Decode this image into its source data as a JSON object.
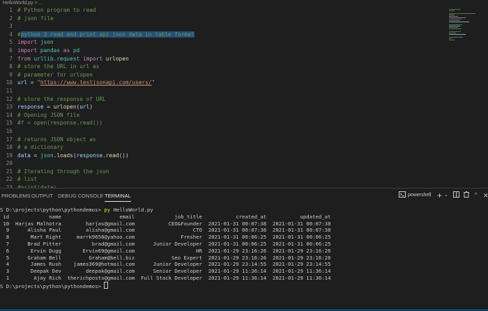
{
  "breadcrumb": "HelloWorld.py > ...",
  "editor": {
    "lines": [
      [
        [
          "# Python program to read",
          "comment"
        ]
      ],
      [
        [
          "# json file",
          "comment"
        ]
      ],
      [],
      [
        [
          "#",
          "comment"
        ],
        [
          "python 3 read and print api json data in table format",
          "sel"
        ]
      ],
      [
        [
          "import",
          "kw"
        ],
        [
          " ",
          "plain"
        ],
        [
          "json",
          "mod"
        ]
      ],
      [
        [
          "import",
          "kw"
        ],
        [
          " ",
          "plain"
        ],
        [
          "pandas",
          "mod"
        ],
        [
          " ",
          "plain"
        ],
        [
          "as",
          "kw"
        ],
        [
          " ",
          "plain"
        ],
        [
          "pd",
          "mod"
        ]
      ],
      [
        [
          "from",
          "kw"
        ],
        [
          " ",
          "plain"
        ],
        [
          "urllib.request",
          "mod"
        ],
        [
          " ",
          "plain"
        ],
        [
          "import",
          "kw"
        ],
        [
          " ",
          "plain"
        ],
        [
          "urlopen",
          "fn"
        ]
      ],
      [
        [
          "# store the URL in url as",
          "comment"
        ]
      ],
      [
        [
          "# parameter for urlopen",
          "comment"
        ]
      ],
      [
        [
          "url",
          "var"
        ],
        [
          " = ",
          "plain"
        ],
        [
          "\"",
          "str"
        ],
        [
          "https://www.testjsonapi.com/users/",
          "url"
        ],
        [
          "\"",
          "str"
        ]
      ],
      [],
      [
        [
          "# store the response of URL",
          "comment"
        ]
      ],
      [
        [
          "response",
          "var"
        ],
        [
          " = ",
          "plain"
        ],
        [
          "urlopen",
          "fn"
        ],
        [
          "(",
          "plain"
        ],
        [
          "url",
          "var"
        ],
        [
          ")",
          "plain"
        ]
      ],
      [
        [
          "# Opening JSON file",
          "comment"
        ]
      ],
      [
        [
          "#f = open(response.read())",
          "comment"
        ]
      ],
      [],
      [
        [
          "# returns JSON object as",
          "comment"
        ]
      ],
      [
        [
          "# a dictionary",
          "comment"
        ]
      ],
      [
        [
          "data",
          "var"
        ],
        [
          " = ",
          "plain"
        ],
        [
          "json",
          "mod"
        ],
        [
          ".",
          "plain"
        ],
        [
          "loads",
          "fn"
        ],
        [
          "(",
          "plain"
        ],
        [
          "response",
          "var"
        ],
        [
          ".",
          "plain"
        ],
        [
          "read",
          "fn"
        ],
        [
          "())",
          "plain"
        ]
      ],
      [],
      [
        [
          "# Iterating through the json",
          "comment"
        ]
      ],
      [
        [
          "# list",
          "comment"
        ]
      ],
      [
        [
          "#print(data)",
          "comment"
        ]
      ]
    ]
  },
  "panel": {
    "tabs": [
      "PROBLEMS",
      "OUTPUT",
      "DEBUG CONSOLE",
      "TERMINAL"
    ],
    "active_tab": "TERMINAL",
    "shell": "powershell"
  },
  "terminal": {
    "prompt": "PS D:\\projects\\python\\pythondemos> ",
    "command_py": "py",
    "command_rest": " HelloWorld.py",
    "columns": [
      "id",
      "name",
      "email",
      "job_title",
      "created_at",
      "updated_at"
    ],
    "rows": [
      [
        "10",
        "Harjas Malhotra",
        "harjas@gmail.com",
        "CEO&Founder",
        "2021-01-31 00:07:38",
        "2021-01-31 00:07:38"
      ],
      [
        "9",
        "Alisha Paul",
        "alisha@gmail.com",
        "CTO",
        "2021-01-31 00:07:38",
        "2021-01-31 00:07:38"
      ],
      [
        "8",
        "Mart Right",
        "marrk9658@yahoo.com",
        "Fresher",
        "2021-01-31 00:06:25",
        "2021-01-31 00:06:25"
      ],
      [
        "7",
        "Brad Pitter",
        "brad@gmail.com",
        "Junior Developer",
        "2021-01-31 00:06:25",
        "2021-01-31 00:06:25"
      ],
      [
        "6",
        "Ervin Dugg",
        "Ervin69@gmail.com",
        "HR",
        "2021-01-29 23:16:26",
        "2021-01-29 23:16:26"
      ],
      [
        "5",
        "Graham Bell",
        "Graham@bell.biz",
        "Seo Expert",
        "2021-01-29 23:16:26",
        "2021-01-29 23:16:26"
      ],
      [
        "4",
        "James Rush",
        "james369@hotmail.com",
        "Junior Developer",
        "2021-01-29 23:14:55",
        "2021-01-29 23:14:55"
      ],
      [
        "3",
        "Deepak Dev",
        "deepak@gmail.com",
        "Senior Developer",
        "2021-01-29 11:36:14",
        "2021-01-29 11:36:14"
      ],
      [
        "1",
        "Ajay Rich",
        "therichposts@gmail.com",
        "Full Stack Developer",
        "2021-01-29 11:36:14",
        "2021-01-29 11:36:14"
      ]
    ]
  }
}
